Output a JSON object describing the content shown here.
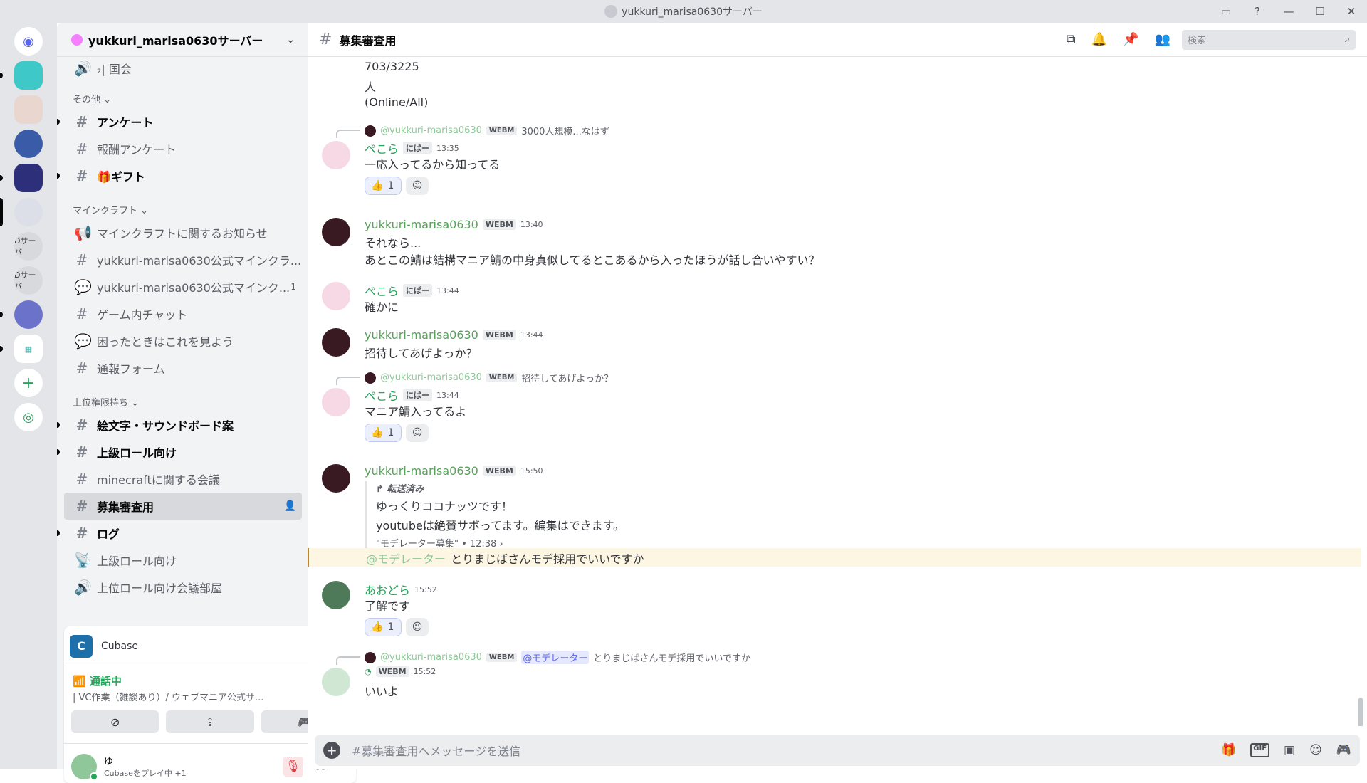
{
  "window": {
    "title": "yukkuri_marisa0630サーバー"
  },
  "server": {
    "name": "yukkuri_marisa0630サーバー"
  },
  "guilds": {
    "labels": [
      "Dサーバ",
      "Dサーバ"
    ]
  },
  "sidebar": {
    "top_channel": "₂| 国会",
    "categories": {
      "other": "その他 ⌄",
      "minecraft": "マインクラフト ⌄",
      "upper": "上位権限持ち ⌄"
    },
    "other_channels": [
      {
        "label": "アンケート"
      },
      {
        "label": "報酬アンケート"
      },
      {
        "label": "🎁ギフト"
      }
    ],
    "minecraft_channels": [
      {
        "label": "マインクラフトに関するお知らせ"
      },
      {
        "label": "yukkuri-marisa0630公式マインクラ..."
      },
      {
        "label": "yukkuri-marisa0630公式マインク...",
        "badge": "1"
      },
      {
        "label": "ゲーム内チャット"
      },
      {
        "label": "困ったときはこれを見よう"
      },
      {
        "label": "通報フォーム"
      }
    ],
    "upper_channels": [
      {
        "label": "絵文字・サウンドボード案"
      },
      {
        "label": "上級ロール向け"
      },
      {
        "label": "minecraftに関する会議"
      },
      {
        "label": "募集審査用"
      },
      {
        "label": "ログ"
      },
      {
        "label": "上級ロール向け"
      },
      {
        "label": "上位ロール向け会議部屋"
      }
    ]
  },
  "voice": {
    "activity_name": "Cubase",
    "status": "通話中",
    "channel": "| VC作業（雑談あり）/ ウェブマニア公式サ..."
  },
  "user": {
    "name": "ゆ",
    "status": "Cubaseをプレイ中 +1"
  },
  "chat": {
    "channel_name": "募集審査用",
    "search_placeholder": "検索",
    "composer_placeholder": "#募集審査用へメッセージを送信"
  },
  "messages": {
    "cont_lines": [
      "703/3225",
      "人",
      "(Online/All)"
    ],
    "m1": {
      "reply_name": "@yukkuri-marisa0630",
      "reply_tag": "WEBM",
      "reply_text": "3000人規模...なはず",
      "user": "ぺこら",
      "tag": "にぱー",
      "time": "13:35",
      "text": "一応入ってるから知ってる",
      "reaction_count": "1"
    },
    "m2": {
      "user": "yukkuri-marisa0630",
      "tag": "WEBM",
      "time": "13:40",
      "line1": "それなら...",
      "line2": "あとこの鯖は結構マニア鯖の中身真似してるとこあるから入ったほうが話し合いやすい？"
    },
    "m3": {
      "user": "ぺこら",
      "tag": "にぱー",
      "time": "13:44",
      "text": "確かに"
    },
    "m4": {
      "user": "yukkuri-marisa0630",
      "tag": "WEBM",
      "time": "13:44",
      "text": "招待してあげよっか？"
    },
    "m5": {
      "reply_name": "@yukkuri-marisa0630",
      "reply_tag": "WEBM",
      "reply_text": "招待してあげよっか？",
      "user": "ぺこら",
      "tag": "にぱー",
      "time": "13:44",
      "text": "マニア鯖入ってるよ",
      "reaction_count": "1"
    },
    "m6": {
      "user": "yukkuri-marisa0630",
      "tag": "WEBM",
      "time": "15:50",
      "fwd_label": "転送済み",
      "fwd_line1": "ゆっくりココナッツです！",
      "fwd_line2": "youtubeは絶賛サボってます。編集はできます。",
      "fwd_meta": "\"モデレーター募集\" • 12:38 ›",
      "mention": "@モデレーター",
      "mention_text": "とりまじばさんモデ採用でいいですか"
    },
    "m7": {
      "user": "あおどら",
      "time": "15:52",
      "text": "了解です",
      "reaction_count": "1"
    },
    "m8": {
      "reply_name": "@yukkuri-marisa0630",
      "reply_tag": "WEBM",
      "reply_mention": "@モデレーター",
      "reply_text": "とりまじばさんモデ採用でいいですか",
      "tag": "WEBM",
      "time": "15:52",
      "text": "いいよ"
    }
  },
  "colors": {
    "online": "#23a55a",
    "mention": "#5865f2",
    "muted": "#da373c"
  }
}
